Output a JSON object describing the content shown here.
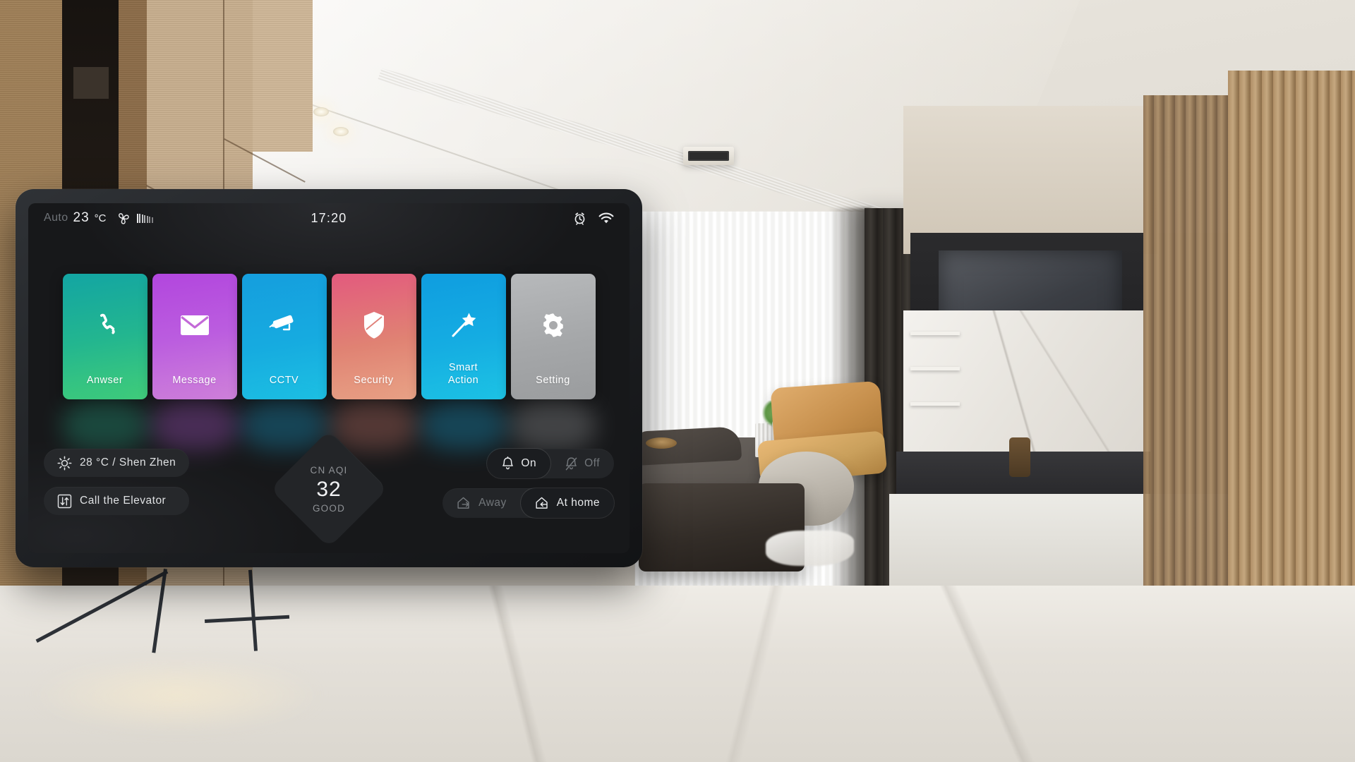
{
  "device": {
    "name": "smart-home-wall-panel"
  },
  "statusbar": {
    "mode_label": "Auto",
    "temperature": "23",
    "unit": "°C",
    "fan_icon": "fan-icon",
    "fan_bars": 7,
    "time": "17:20",
    "alarm_icon": "alarm-clock-icon",
    "wifi_icon": "wifi-icon"
  },
  "tiles": [
    {
      "id": "answer",
      "label": "Anwser",
      "icon": "phone-icon",
      "color_from": "#13a5a3",
      "color_to": "#41cd79"
    },
    {
      "id": "message",
      "label": "Message",
      "icon": "envelope-icon",
      "color_from": "#b246de",
      "color_to": "#cf82d9"
    },
    {
      "id": "cctv",
      "label": "CCTV",
      "icon": "cctv-camera-icon",
      "color_from": "#159ede",
      "color_to": "#1dc0e2"
    },
    {
      "id": "security",
      "label": "Security",
      "icon": "shield-icon",
      "color_from": "#e35a7e",
      "color_to": "#e8a386"
    },
    {
      "id": "smart",
      "label": "Smart\nAction",
      "icon": "magic-wand-icon",
      "color_from": "#0f9de0",
      "color_to": "#1dc3e4"
    },
    {
      "id": "setting",
      "label": "Setting",
      "icon": "gear-icon",
      "color_from": "#b7b9bb",
      "color_to": "#9a9c9e"
    }
  ],
  "tile_labels": {
    "answer": "Anwser",
    "message": "Message",
    "cctv": "CCTV",
    "security": "Security",
    "smart_line1": "Smart",
    "smart_line2": "Action",
    "setting": "Setting"
  },
  "weather": {
    "icon": "sun-icon",
    "text": "28 °C / Shen Zhen"
  },
  "elevator": {
    "icon": "elevator-arrows-icon",
    "label": "Call the Elevator"
  },
  "aqi": {
    "label": "CN AQI",
    "value": "32",
    "state": "GOOD"
  },
  "bell_toggle": {
    "on_label": "On",
    "on_icon": "bell-icon",
    "off_label": "Off",
    "off_icon": "bell-slash-icon",
    "selected": "On"
  },
  "presence_toggle": {
    "away_label": "Away",
    "away_icon": "house-arrow-out-icon",
    "home_label": "At home",
    "home_icon": "house-arrow-in-icon",
    "selected": "At home"
  }
}
